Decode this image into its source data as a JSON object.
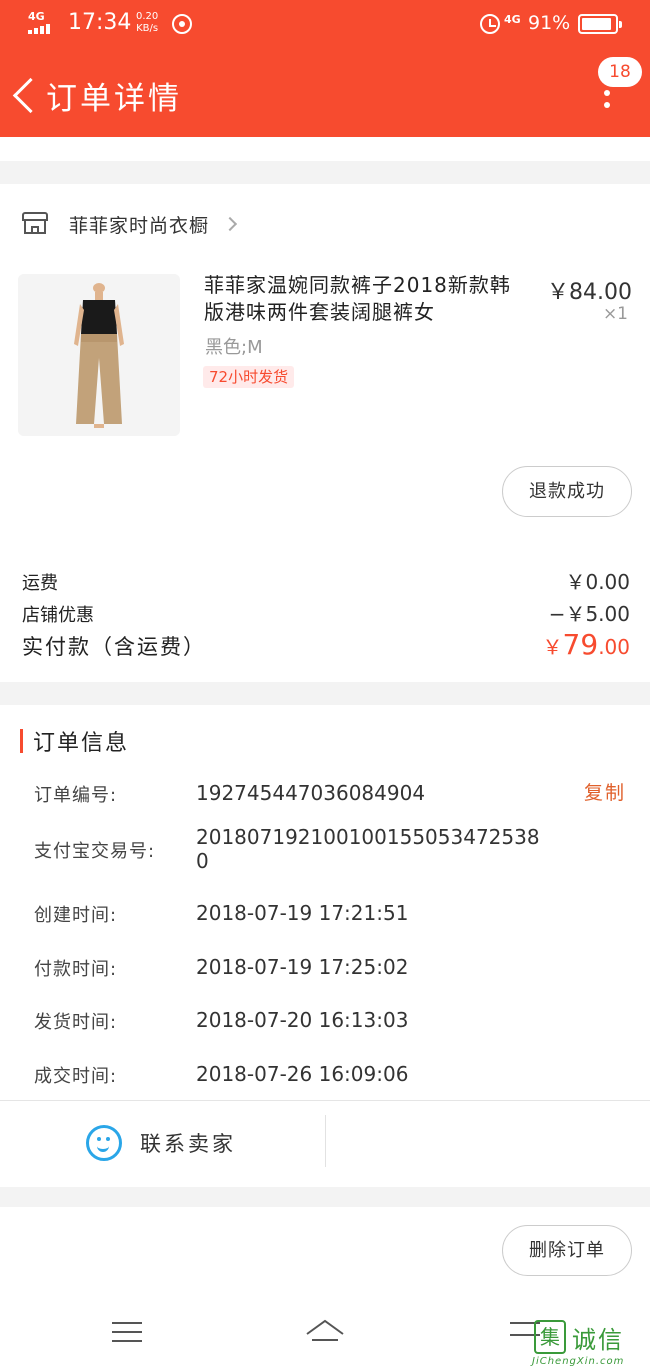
{
  "status_bar": {
    "network_label": "4G",
    "time": "17:34",
    "speed_value": "0.20",
    "speed_unit": "KB/s",
    "network_right": "4G",
    "battery_text": "91%",
    "battery_level": 0.91
  },
  "nav": {
    "title": "订单详情",
    "badge": "18"
  },
  "shop": {
    "name": "菲菲家时尚衣橱"
  },
  "product": {
    "title": "菲菲家温婉同款裤子2018新款韩版港味两件套装阔腿裤女",
    "price": "￥84.00",
    "qty": "×1",
    "sku": "黑色;M",
    "tag": "72小时发货",
    "refund_status": "退款成功"
  },
  "fees": {
    "shipping_label": "运费",
    "shipping_value": "￥0.00",
    "discount_label": "店铺优惠",
    "discount_value": "−￥5.00",
    "total_label": "实付款（含运费）",
    "total_currency": "￥",
    "total_int": "79",
    "total_dec": ".00"
  },
  "order_info": {
    "heading": "订单信息",
    "copy_label": "复制",
    "rows": [
      {
        "label": "订单编号:",
        "value": "192745447036084904"
      },
      {
        "label": "支付宝交易号:",
        "value": "2018071921001001550534725380"
      },
      {
        "label": "创建时间:",
        "value": "2018-07-19 17:21:51"
      },
      {
        "label": "付款时间:",
        "value": "2018-07-19 17:25:02"
      },
      {
        "label": "发货时间:",
        "value": "2018-07-20 16:13:03"
      },
      {
        "label": "成交时间:",
        "value": "2018-07-26 16:09:06"
      }
    ]
  },
  "contact": {
    "label": "联系卖家"
  },
  "bottom": {
    "delete_label": "删除订单"
  },
  "watermark": {
    "logo_char": "集",
    "text": "诚信",
    "sub": "JiChengXin.com"
  },
  "colors": {
    "brand": "#f74b2f",
    "price_accent": "#f74b2f",
    "copy": "#e0602b",
    "contact_icon": "#2aa6e8"
  },
  "icons": {
    "back": "chevron-left-icon",
    "more": "more-vertical-icon",
    "shop": "store-icon",
    "shop_chevron": "chevron-right-icon",
    "contact": "chat-smile-icon"
  }
}
